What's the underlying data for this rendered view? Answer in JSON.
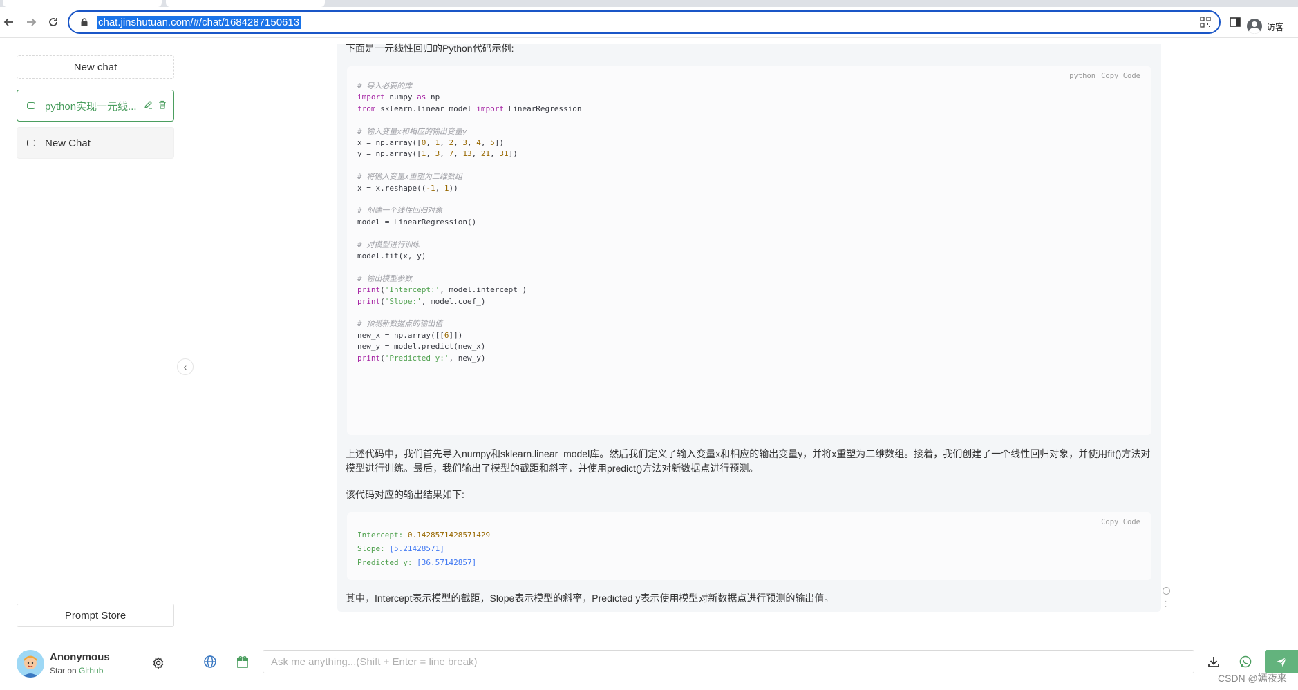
{
  "browser": {
    "url": "chat.jinshutuan.com/#/chat/1684287150613",
    "profile_label": "访客",
    "icons": [
      "back-icon",
      "forward-icon",
      "reload-icon",
      "lock-icon",
      "qr-code-icon",
      "sidepanel-icon",
      "profile-icon"
    ]
  },
  "sidebar": {
    "new_chat_label": "New chat",
    "chats": [
      {
        "label": "python实现一元线...",
        "active": true
      },
      {
        "label": "New Chat",
        "active": false
      }
    ],
    "prompt_store_label": "Prompt Store",
    "user": {
      "name": "Anonymous",
      "sub_prefix": "Star on",
      "sub_link": "Github"
    }
  },
  "message": {
    "intro": "下面是一元线性回归的Python代码示例:",
    "code_lang": "python",
    "copy_code": "Copy Code",
    "code_lines": [
      {
        "t": "# 导入必要的库",
        "k": "com"
      },
      {
        "t": "import numpy as np",
        "k": "import"
      },
      {
        "t": "from sklearn.linear_model import LinearRegression",
        "k": "from"
      },
      {
        "t": "",
        "k": "blank"
      },
      {
        "t": "# 输入变量x和相应的输出变量y",
        "k": "com"
      },
      {
        "t": "x = np.array([0, 1, 2, 3, 4, 5])",
        "k": "plain"
      },
      {
        "t": "y = np.array([1, 3, 7, 13, 21, 31])",
        "k": "plain"
      },
      {
        "t": "",
        "k": "blank"
      },
      {
        "t": "# 将输入变量x重塑为二维数组",
        "k": "com"
      },
      {
        "t": "x = x.reshape((-1, 1))",
        "k": "plain"
      },
      {
        "t": "",
        "k": "blank"
      },
      {
        "t": "# 创建一个线性回归对象",
        "k": "com"
      },
      {
        "t": "model = LinearRegression()",
        "k": "plain"
      },
      {
        "t": "",
        "k": "blank"
      },
      {
        "t": "# 对模型进行训练",
        "k": "com"
      },
      {
        "t": "model.fit(x, y)",
        "k": "plain"
      },
      {
        "t": "",
        "k": "blank"
      },
      {
        "t": "# 输出模型参数",
        "k": "com"
      },
      {
        "t": "print('Intercept:', model.intercept_)",
        "k": "print"
      },
      {
        "t": "print('Slope:', model.coef_)",
        "k": "print"
      },
      {
        "t": "",
        "k": "blank"
      },
      {
        "t": "# 预测新数据点的输出值",
        "k": "com"
      },
      {
        "t": "new_x = np.array([[6]])",
        "k": "plain"
      },
      {
        "t": "new_y = model.predict(new_x)",
        "k": "plain"
      },
      {
        "t": "print('Predicted y:', new_y)",
        "k": "print"
      }
    ],
    "explain_1": "上述代码中，我们首先导入numpy和sklearn.linear_model库。然后我们定义了输入变量x和相应的输出变量y，并将x重塑为二维数组。接着，我们创建了一个线性回归对象，并使用fit()方法对",
    "explain_2": "模型进行训练。最后，我们输出了模型的截距和斜率，并使用predict()方法对新数据点进行预测。",
    "output_intro": "该代码对应的输出结果如下:",
    "output_lines": [
      {
        "label": "Intercept",
        "value": "0.1428571428571429"
      },
      {
        "label": "Slope",
        "value": "[5.21428571]"
      },
      {
        "label": "Predicted y",
        "value": "[36.57142857]"
      }
    ],
    "conclusion": "其中，Intercept表示模型的截距，Slope表示模型的斜率，Predicted y表示使用模型对新数据点进行预测的输出值。"
  },
  "composer": {
    "placeholder": "Ask me anything...(Shift + Enter = line break)"
  },
  "watermark": "CSDN @嫣夜来",
  "colors": {
    "accent": "#4b9e5f",
    "send": "#63b37d",
    "url_highlight": "#1a73e8"
  }
}
